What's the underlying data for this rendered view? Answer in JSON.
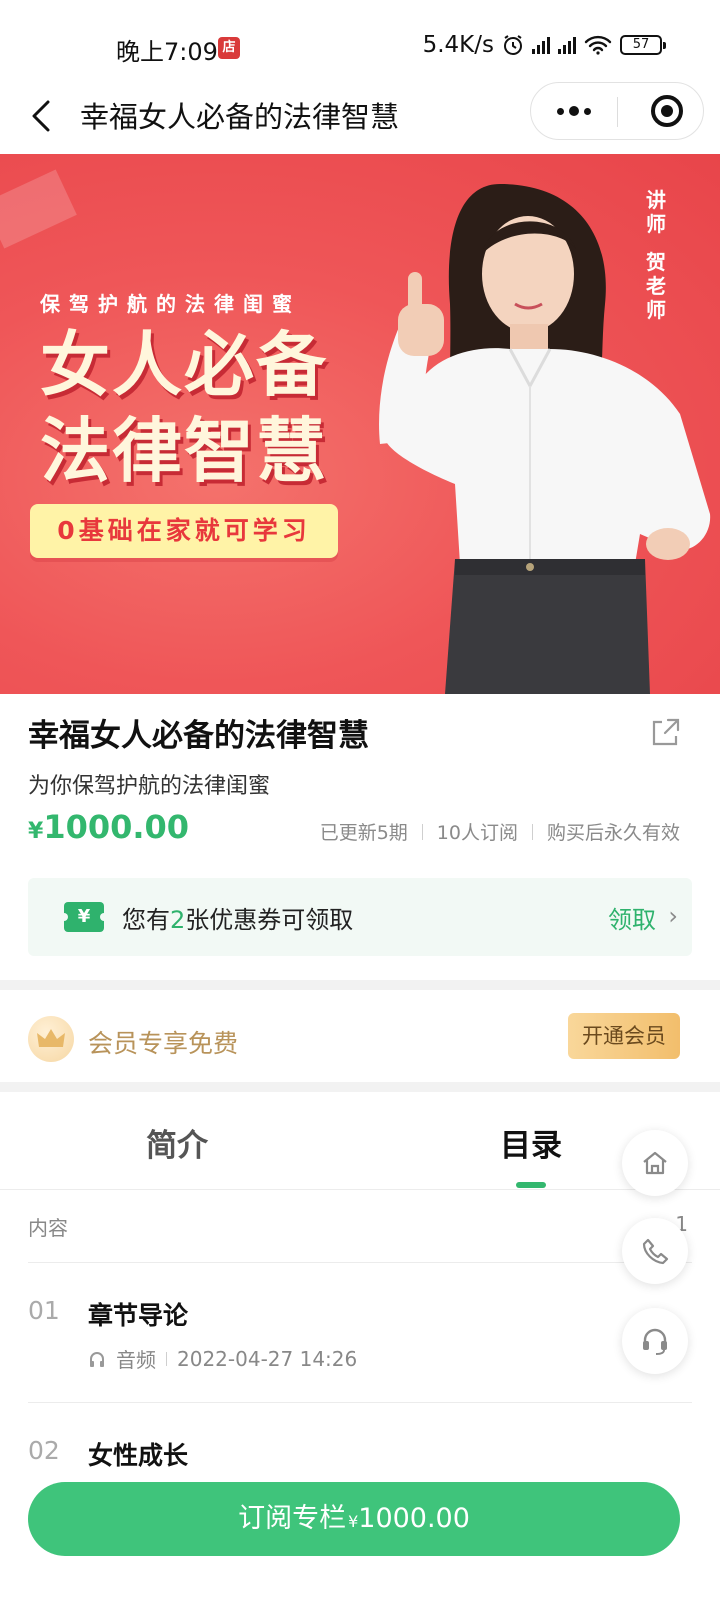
{
  "status_bar": {
    "time": "晚上7:09",
    "app_badge": "店",
    "net_speed": "5.4K/s",
    "battery": "57"
  },
  "nav": {
    "title": "幸福女人必备的法律智慧"
  },
  "banner": {
    "subtitle": "保驾护航的法律闺蜜",
    "headline_line1": "女人必备",
    "headline_line2": "法律智慧",
    "pill": "0基础在家就可学习",
    "lecturer_role": "讲师",
    "lecturer_name": "贺老师"
  },
  "course": {
    "title": "幸福女人必备的法律智慧",
    "subtitle": "为你保驾护航的法律闺蜜",
    "price_currency": "¥",
    "price": "1000.00",
    "meta": [
      "已更新5期",
      "10人订阅",
      "购买后永久有效"
    ]
  },
  "coupon": {
    "prefix": "您有",
    "count": "2",
    "suffix": "张优惠券可领取",
    "claim": "领取",
    "icon_text": "¥"
  },
  "member": {
    "text": "会员专享免费",
    "button": "开通会员"
  },
  "tabs": {
    "intro": "简介",
    "catalog": "目录"
  },
  "list": {
    "head_left": "内容",
    "head_right": "1",
    "items": [
      {
        "no": "01",
        "title": "章节导论",
        "type": "音频",
        "date": "2022-04-27 14:26"
      },
      {
        "no": "02",
        "title": "女性成长"
      }
    ]
  },
  "subscribe": {
    "label": "订阅专栏",
    "currency": "¥",
    "price": "1000.00"
  },
  "colors": {
    "accent": "#33b76e",
    "banner_red": "#ef5658",
    "gold": "#b8935a"
  }
}
